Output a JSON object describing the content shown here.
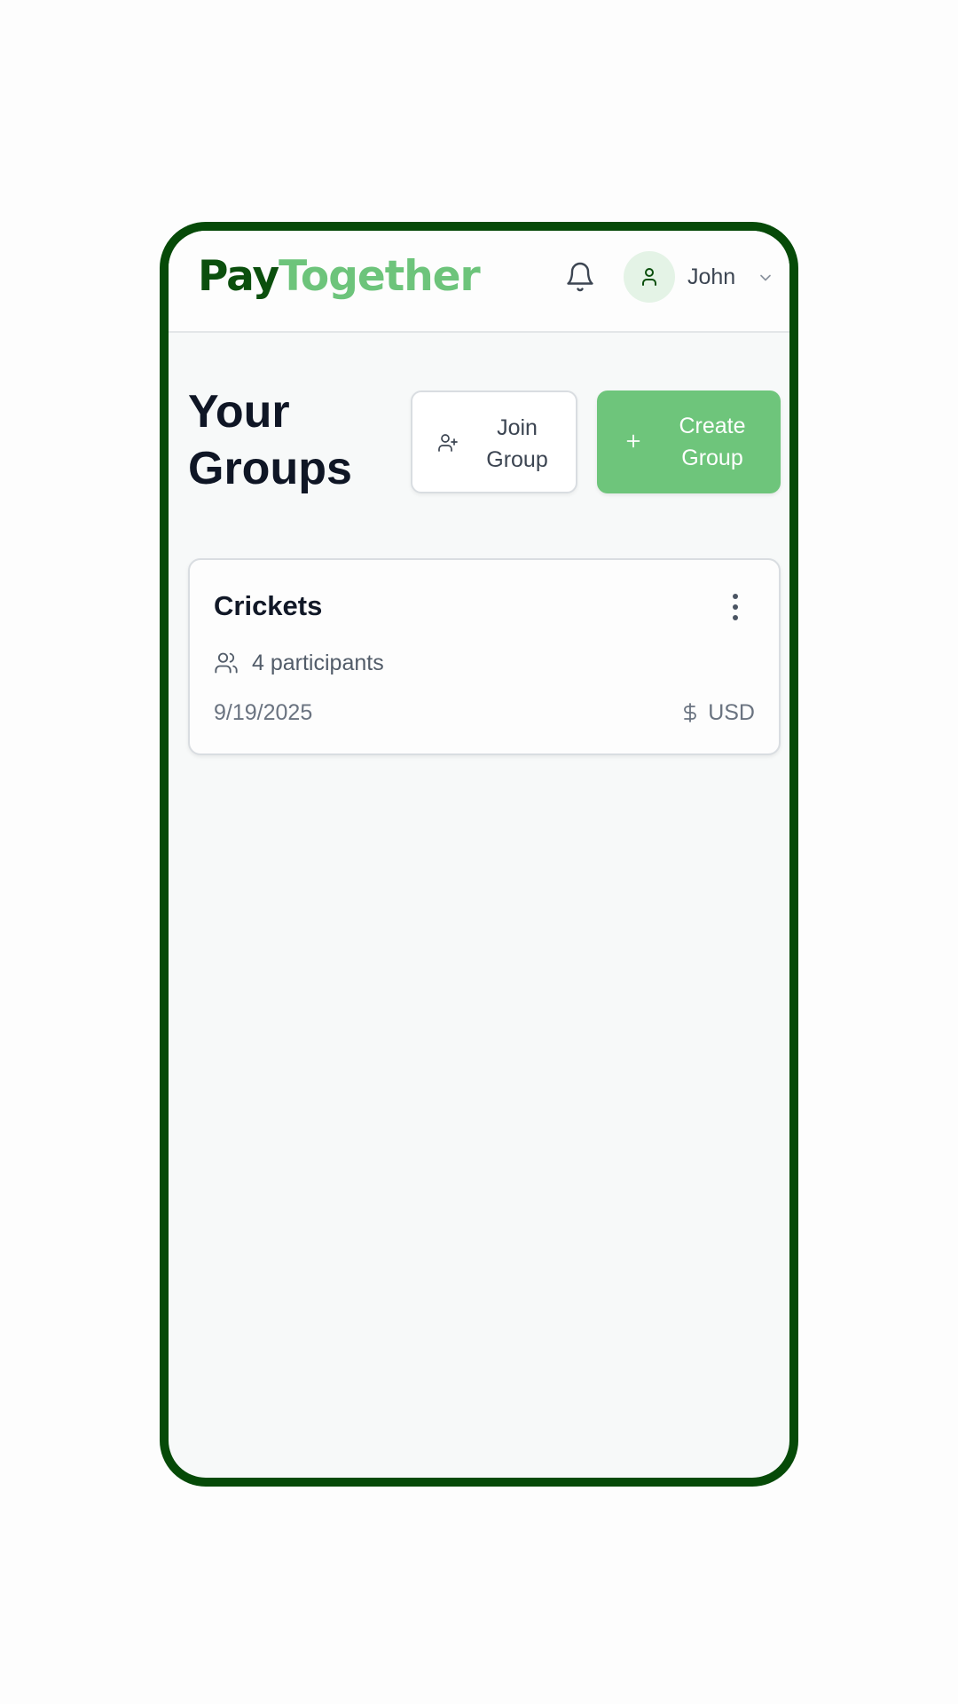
{
  "app": {
    "logo_part1": "Pay",
    "logo_part2": "Together",
    "brand_dark": "#0b4f0d",
    "brand_light": "#6dc47b",
    "frame_color": "#064a08"
  },
  "header": {
    "notifications_icon": "bell-icon",
    "user": {
      "avatar_icon": "user-icon",
      "name": "John",
      "menu_icon": "chevron-down-icon"
    }
  },
  "main": {
    "title": "Your Groups",
    "join_button": {
      "label": "Join Group",
      "icon": "user-plus-icon"
    },
    "create_button": {
      "label": "Create Group",
      "icon": "plus-icon"
    },
    "groups": [
      {
        "name": "Crickets",
        "participants": "4 participants",
        "date": "9/19/2025",
        "currency": "USD",
        "menu_icon": "more-vertical-icon",
        "participants_icon": "users-icon",
        "currency_icon": "dollar-sign-icon"
      }
    ]
  }
}
